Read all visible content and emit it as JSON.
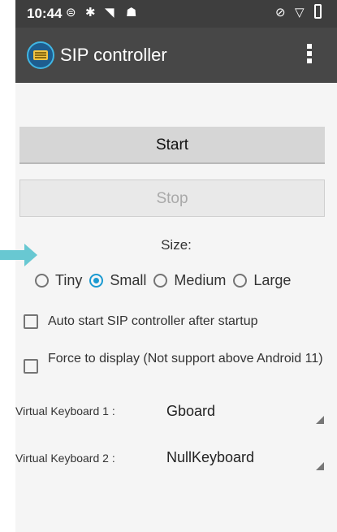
{
  "status_bar": {
    "time": "10:44",
    "icons": [
      "sim-icon",
      "settings-icon",
      "wifi-icon",
      "bug-icon",
      "mute-icon",
      "location-icon",
      "battery-icon"
    ]
  },
  "app_bar": {
    "title": "SIP controller",
    "icon": "keyboard-icon",
    "menu_icon": "overflow-menu-icon"
  },
  "buttons": {
    "start": "Start",
    "stop": "Stop"
  },
  "size": {
    "label": "Size:",
    "options": [
      "Tiny",
      "Small",
      "Medium",
      "Large"
    ],
    "selected": "Small"
  },
  "checkboxes": [
    {
      "label": "Auto start SIP controller after startup",
      "checked": false
    },
    {
      "label": "Force to display (Not support above Android 11)",
      "checked": false
    }
  ],
  "keyboards": [
    {
      "label": "Virtual Keyboard 1 :",
      "value": "Gboard"
    },
    {
      "label": "Virtual Keyboard 2 :",
      "value": "NullKeyboard"
    }
  ],
  "colors": {
    "accent": "#1b9ad1",
    "arrow": "#68c8d2",
    "appbar": "#474747",
    "statusbar": "#3e3e3e"
  }
}
